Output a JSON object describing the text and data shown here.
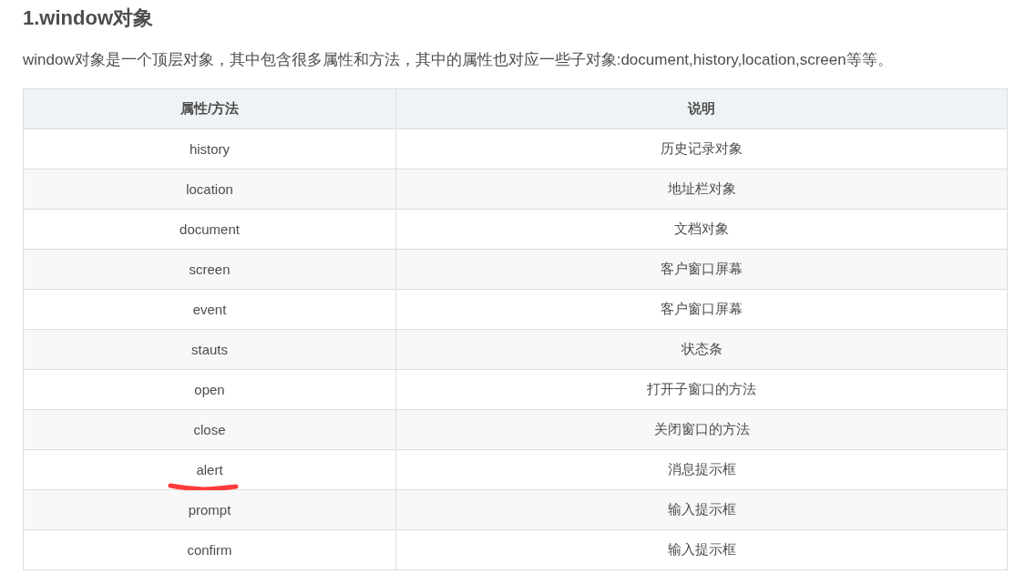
{
  "heading": "1.window对象",
  "intro": "window对象是一个顶层对象，其中包含很多属性和方法，其中的属性也对应一些子对象:document,history,location,screen等等。",
  "table": {
    "columns": [
      "属性/方法",
      "说明"
    ],
    "rows": [
      {
        "cells": [
          "history",
          "历史记录对象"
        ],
        "underlined": false
      },
      {
        "cells": [
          "location",
          "地址栏对象"
        ],
        "underlined": false
      },
      {
        "cells": [
          "document",
          "文档对象"
        ],
        "underlined": false
      },
      {
        "cells": [
          "screen",
          "客户窗口屏幕"
        ],
        "underlined": false
      },
      {
        "cells": [
          "event",
          "客户窗口屏幕"
        ],
        "underlined": false
      },
      {
        "cells": [
          "stauts",
          "状态条"
        ],
        "underlined": false
      },
      {
        "cells": [
          "open",
          "打开子窗口的方法"
        ],
        "underlined": false
      },
      {
        "cells": [
          "close",
          "关闭窗口的方法"
        ],
        "underlined": false
      },
      {
        "cells": [
          "alert",
          "消息提示框"
        ],
        "underlined": true
      },
      {
        "cells": [
          "prompt",
          "输入提示框"
        ],
        "underlined": false
      },
      {
        "cells": [
          "confirm",
          "输入提示框"
        ],
        "underlined": false
      }
    ]
  }
}
